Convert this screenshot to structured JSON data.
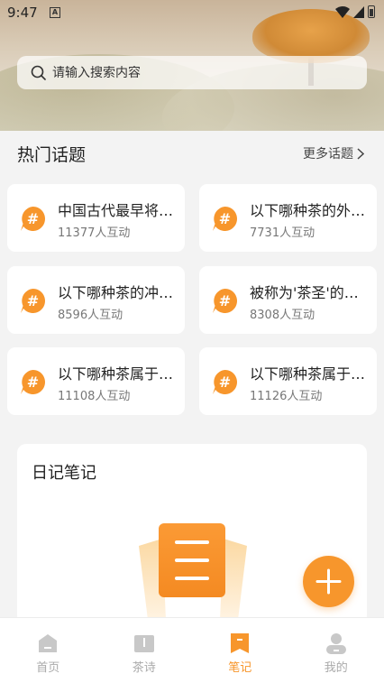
{
  "status": {
    "time": "9:47",
    "a_label": "A"
  },
  "search": {
    "placeholder": "请输入搜索内容"
  },
  "topics_section": {
    "title": "热门话题",
    "more_label": "更多话题"
  },
  "topics": [
    {
      "title": "中国古代最早将…",
      "count": "11377人互动"
    },
    {
      "title": "以下哪种茶的外…",
      "count": "7731人互动"
    },
    {
      "title": "以下哪种茶的冲…",
      "count": "8596人互动"
    },
    {
      "title": "被称为'茶圣'的…",
      "count": "8308人互动"
    },
    {
      "title": "以下哪种茶属于…",
      "count": "11108人互动"
    },
    {
      "title": "以下哪种茶属于…",
      "count": "11126人互动"
    }
  ],
  "diary": {
    "title": "日记笔记"
  },
  "nav": [
    {
      "label": "首页",
      "icon": "home-icon"
    },
    {
      "label": "茶诗",
      "icon": "book-icon"
    },
    {
      "label": "笔记",
      "icon": "note-icon",
      "active": true
    },
    {
      "label": "我的",
      "icon": "profile-icon"
    }
  ],
  "colors": {
    "accent": "#f7962c",
    "background": "#f3f3f3",
    "card": "#ffffff"
  }
}
